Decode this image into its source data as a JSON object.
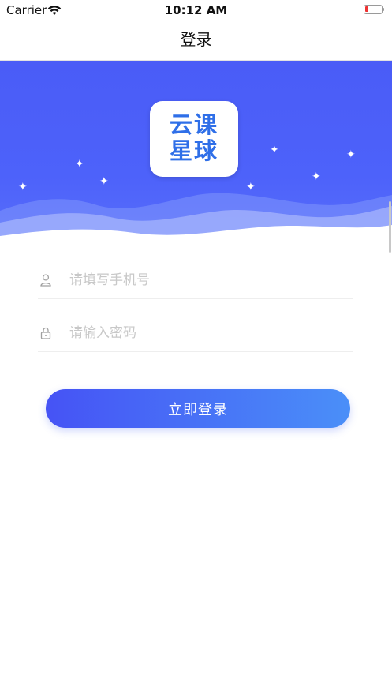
{
  "status_bar": {
    "carrier": "Carrier",
    "time": "10:12 AM",
    "wifi_icon": "wifi-icon",
    "battery_icon": "battery-low-icon",
    "battery_color": "#e33333"
  },
  "nav": {
    "title": "登录"
  },
  "hero": {
    "logo_line1": "云课",
    "logo_line2": "星球",
    "logo_color": "#2f6fe8",
    "background_color": "#4d62fa",
    "star_icon": "sparkle-star-icon"
  },
  "form": {
    "phone": {
      "icon": "user-icon",
      "placeholder": "请填写手机号",
      "value": ""
    },
    "password": {
      "icon": "lock-icon",
      "placeholder": "请输入密码",
      "value": ""
    }
  },
  "login_button": {
    "label": "立即登录",
    "gradient_start": "#4653f5",
    "gradient_end": "#4a8ff8"
  }
}
